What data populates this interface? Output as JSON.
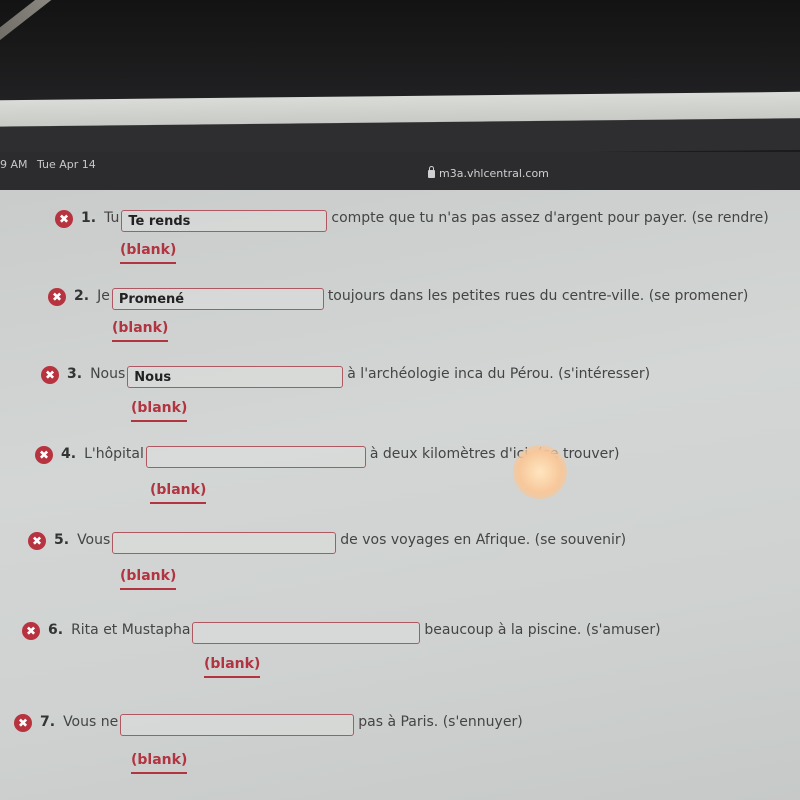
{
  "status_bar": {
    "time": "9 AM",
    "date": "Tue Apr 14",
    "url": "m3a.vhlcentral.com"
  },
  "questions": [
    {
      "number": "1.",
      "before": "Tu",
      "answer": "Te rends",
      "after": "compte que tu n'as pas assez d'argent pour payer. (se rendre)",
      "feedback": "(blank)",
      "status": "incorrect"
    },
    {
      "number": "2.",
      "before": "Je",
      "answer": "Promené",
      "after": "toujours dans les petites rues du centre-ville. (se promener)",
      "feedback": "(blank)",
      "status": "incorrect"
    },
    {
      "number": "3.",
      "before": "Nous",
      "answer": "Nous",
      "after": "à l'archéologie inca du Pérou. (s'intéresser)",
      "feedback": "(blank)",
      "status": "incorrect"
    },
    {
      "number": "4.",
      "before": "L'hôpital",
      "answer": "",
      "after": "à deux kilomètres d'ici. (se trouver)",
      "feedback": "(blank)",
      "status": "incorrect"
    },
    {
      "number": "5.",
      "before": "Vous",
      "answer": "",
      "after": "de vos voyages en Afrique. (se souvenir)",
      "feedback": "(blank)",
      "status": "incorrect"
    },
    {
      "number": "6.",
      "before": "Rita et Mustapha",
      "answer": "",
      "after": "beaucoup à la piscine. (s'amuser)",
      "feedback": "(blank)",
      "status": "incorrect"
    },
    {
      "number": "7.",
      "before": "Vous ne",
      "answer": "",
      "after": "pas à Paris. (s'ennuyer)",
      "feedback": "(blank)",
      "status": "incorrect"
    }
  ],
  "icons": {
    "incorrect": "✖"
  },
  "colors": {
    "error": "#b7333f",
    "feedback": "#b23441"
  }
}
